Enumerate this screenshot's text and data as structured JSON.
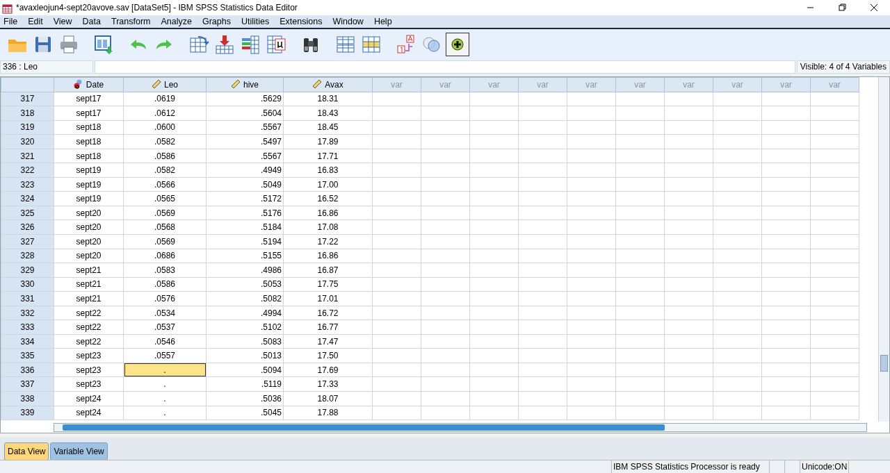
{
  "window": {
    "title": "*avaxleojun4-sept20avove.sav [DataSet5] - IBM SPSS Statistics Data Editor"
  },
  "menu": [
    "File",
    "Edit",
    "View",
    "Data",
    "Transform",
    "Analyze",
    "Graphs",
    "Utilities",
    "Extensions",
    "Window",
    "Help"
  ],
  "toolbar": [
    {
      "kind": "open",
      "pressed": false
    },
    {
      "kind": "save",
      "pressed": false
    },
    {
      "kind": "print",
      "pressed": false
    },
    {
      "kind": "dialog",
      "pressed": false
    },
    {
      "kind": "undo",
      "pressed": false
    },
    {
      "kind": "redo",
      "pressed": false
    },
    {
      "kind": "goto-case",
      "pressed": false
    },
    {
      "kind": "insert-case",
      "pressed": false
    },
    {
      "kind": "variables",
      "pressed": false
    },
    {
      "kind": "stats",
      "pressed": false
    },
    {
      "kind": "find",
      "pressed": false
    },
    {
      "kind": "split",
      "pressed": false
    },
    {
      "kind": "select",
      "pressed": false
    },
    {
      "kind": "labels",
      "pressed": false
    },
    {
      "kind": "sets",
      "pressed": false
    },
    {
      "kind": "add",
      "pressed": true
    }
  ],
  "cell_bar": {
    "reference": "336 : Leo",
    "visible": "Visible: 4 of 4 Variables"
  },
  "columns": [
    {
      "label": "Date",
      "kind": "nominal"
    },
    {
      "label": "Leo",
      "kind": "scale"
    },
    {
      "label": "hive",
      "kind": "scale"
    },
    {
      "label": "Avax",
      "kind": "scale"
    },
    {
      "label": "var",
      "kind": "empty"
    },
    {
      "label": "var",
      "kind": "empty"
    },
    {
      "label": "var",
      "kind": "empty"
    },
    {
      "label": "var",
      "kind": "empty"
    },
    {
      "label": "var",
      "kind": "empty"
    },
    {
      "label": "var",
      "kind": "empty"
    },
    {
      "label": "var",
      "kind": "empty"
    },
    {
      "label": "var",
      "kind": "empty"
    },
    {
      "label": "var",
      "kind": "empty"
    },
    {
      "label": "var",
      "kind": "empty"
    }
  ],
  "rows": [
    {
      "number": "317",
      "cells": [
        {
          "text": "sept17",
          "selected": false
        },
        {
          "text": ".0619",
          "selected": false
        },
        {
          "text": ".5629",
          "selected": false
        },
        {
          "text": "18.31",
          "selected": false
        }
      ]
    },
    {
      "number": "318",
      "cells": [
        {
          "text": "sept17",
          "selected": false
        },
        {
          "text": ".0612",
          "selected": false
        },
        {
          "text": ".5604",
          "selected": false
        },
        {
          "text": "18.43",
          "selected": false
        }
      ]
    },
    {
      "number": "319",
      "cells": [
        {
          "text": "sept18",
          "selected": false
        },
        {
          "text": ".0600",
          "selected": false
        },
        {
          "text": ".5567",
          "selected": false
        },
        {
          "text": "18.45",
          "selected": false
        }
      ]
    },
    {
      "number": "320",
      "cells": [
        {
          "text": "sept18",
          "selected": false
        },
        {
          "text": ".0582",
          "selected": false
        },
        {
          "text": ".5497",
          "selected": false
        },
        {
          "text": "17.89",
          "selected": false
        }
      ]
    },
    {
      "number": "321",
      "cells": [
        {
          "text": "sept18",
          "selected": false
        },
        {
          "text": ".0586",
          "selected": false
        },
        {
          "text": ".5567",
          "selected": false
        },
        {
          "text": "17.71",
          "selected": false
        }
      ]
    },
    {
      "number": "322",
      "cells": [
        {
          "text": "sept19",
          "selected": false
        },
        {
          "text": ".0582",
          "selected": false
        },
        {
          "text": ".4949",
          "selected": false
        },
        {
          "text": "16.83",
          "selected": false
        }
      ]
    },
    {
      "number": "323",
      "cells": [
        {
          "text": "sept19",
          "selected": false
        },
        {
          "text": ".0566",
          "selected": false
        },
        {
          "text": ".5049",
          "selected": false
        },
        {
          "text": "17.00",
          "selected": false
        }
      ]
    },
    {
      "number": "324",
      "cells": [
        {
          "text": "sept19",
          "selected": false
        },
        {
          "text": ".0565",
          "selected": false
        },
        {
          "text": ".5172",
          "selected": false
        },
        {
          "text": "16.52",
          "selected": false
        }
      ]
    },
    {
      "number": "325",
      "cells": [
        {
          "text": "sept20",
          "selected": false
        },
        {
          "text": ".0569",
          "selected": false
        },
        {
          "text": ".5176",
          "selected": false
        },
        {
          "text": "16.86",
          "selected": false
        }
      ]
    },
    {
      "number": "326",
      "cells": [
        {
          "text": "sept20",
          "selected": false
        },
        {
          "text": ".0568",
          "selected": false
        },
        {
          "text": ".5184",
          "selected": false
        },
        {
          "text": "17.08",
          "selected": false
        }
      ]
    },
    {
      "number": "327",
      "cells": [
        {
          "text": "sept20",
          "selected": false
        },
        {
          "text": ".0569",
          "selected": false
        },
        {
          "text": ".5194",
          "selected": false
        },
        {
          "text": "17.22",
          "selected": false
        }
      ]
    },
    {
      "number": "328",
      "cells": [
        {
          "text": "sept20",
          "selected": false
        },
        {
          "text": ".0686",
          "selected": false
        },
        {
          "text": ".5155",
          "selected": false
        },
        {
          "text": "16.86",
          "selected": false
        }
      ]
    },
    {
      "number": "329",
      "cells": [
        {
          "text": "sept21",
          "selected": false
        },
        {
          "text": ".0583",
          "selected": false
        },
        {
          "text": ".4986",
          "selected": false
        },
        {
          "text": "16.87",
          "selected": false
        }
      ]
    },
    {
      "number": "330",
      "cells": [
        {
          "text": "sept21",
          "selected": false
        },
        {
          "text": ".0586",
          "selected": false
        },
        {
          "text": ".5053",
          "selected": false
        },
        {
          "text": "17.75",
          "selected": false
        }
      ]
    },
    {
      "number": "331",
      "cells": [
        {
          "text": "sept21",
          "selected": false
        },
        {
          "text": ".0576",
          "selected": false
        },
        {
          "text": ".5082",
          "selected": false
        },
        {
          "text": "17.01",
          "selected": false
        }
      ]
    },
    {
      "number": "332",
      "cells": [
        {
          "text": "sept22",
          "selected": false
        },
        {
          "text": ".0534",
          "selected": false
        },
        {
          "text": ".4994",
          "selected": false
        },
        {
          "text": "16.72",
          "selected": false
        }
      ]
    },
    {
      "number": "333",
      "cells": [
        {
          "text": "sept22",
          "selected": false
        },
        {
          "text": ".0537",
          "selected": false
        },
        {
          "text": ".5102",
          "selected": false
        },
        {
          "text": "16.77",
          "selected": false
        }
      ]
    },
    {
      "number": "334",
      "cells": [
        {
          "text": "sept22",
          "selected": false
        },
        {
          "text": ".0546",
          "selected": false
        },
        {
          "text": ".5083",
          "selected": false
        },
        {
          "text": "17.47",
          "selected": false
        }
      ]
    },
    {
      "number": "335",
      "cells": [
        {
          "text": "sept23",
          "selected": false
        },
        {
          "text": ".0557",
          "selected": false
        },
        {
          "text": ".5013",
          "selected": false
        },
        {
          "text": "17.50",
          "selected": false
        }
      ]
    },
    {
      "number": "336",
      "cells": [
        {
          "text": "sept23",
          "selected": false
        },
        {
          "text": ".",
          "selected": true
        },
        {
          "text": ".5094",
          "selected": false
        },
        {
          "text": "17.69",
          "selected": false
        }
      ]
    },
    {
      "number": "337",
      "cells": [
        {
          "text": "sept23",
          "selected": false
        },
        {
          "text": ".",
          "selected": false
        },
        {
          "text": ".5119",
          "selected": false
        },
        {
          "text": "17.33",
          "selected": false
        }
      ]
    },
    {
      "number": "338",
      "cells": [
        {
          "text": "sept24",
          "selected": false
        },
        {
          "text": ".",
          "selected": false
        },
        {
          "text": ".5036",
          "selected": false
        },
        {
          "text": "18.07",
          "selected": false
        }
      ]
    },
    {
      "number": "339",
      "cells": [
        {
          "text": "sept24",
          "selected": false
        },
        {
          "text": ".",
          "selected": false
        },
        {
          "text": ".5045",
          "selected": false
        },
        {
          "text": "17.88",
          "selected": false
        }
      ]
    }
  ],
  "view_tabs": [
    {
      "label": "Data View",
      "selected": true
    },
    {
      "label": "Variable View",
      "selected": false
    }
  ],
  "status_bar": {
    "message": "IBM SPSS Statistics Processor is ready",
    "encoding": "Unicode:ON"
  }
}
